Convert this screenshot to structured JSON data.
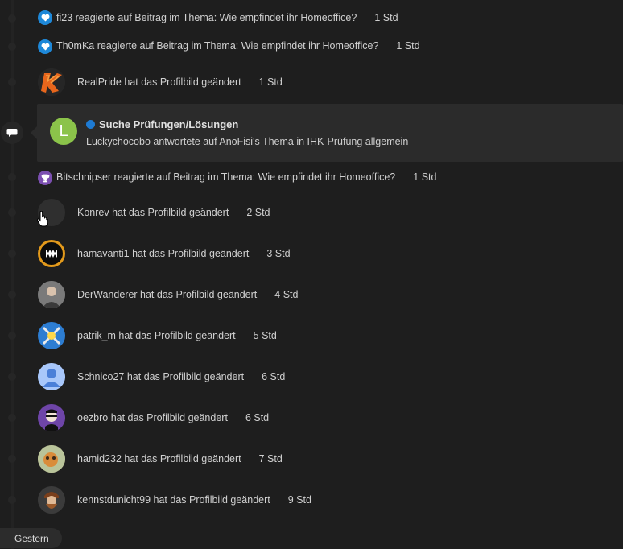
{
  "colors": {
    "background": "#1e1e1e",
    "card": "#2b2b2b",
    "heart": "#1e88d8",
    "trophy": "#7b4fb0",
    "unread": "#1e7bd4"
  },
  "items": [
    {
      "text": "fi23 reagierte auf Beitrag im Thema: Wie empfindet ihr Homeoffice?",
      "time": "1 Std",
      "icon": "heart-icon"
    },
    {
      "text": "Th0mKa reagierte auf Beitrag im Thema: Wie empfindet ihr Homeoffice?",
      "time": "1 Std",
      "icon": "heart-icon"
    },
    {
      "text": "RealPride hat das Profilbild geändert",
      "time": "1 Std",
      "icon": "avatar"
    },
    {
      "text": "Bitschnipser reagierte auf Beitrag im Thema: Wie empfindet ihr Homeoffice?",
      "time": "1 Std",
      "icon": "trophy-icon"
    },
    {
      "text": "Konrev hat das Profilbild geändert",
      "time": "2 Std",
      "icon": "avatar"
    },
    {
      "text": "hamavanti1 hat das Profilbild geändert",
      "time": "3 Std",
      "icon": "avatar"
    },
    {
      "text": "DerWanderer hat das Profilbild geändert",
      "time": "4 Std",
      "icon": "avatar"
    },
    {
      "text": "patrik_m hat das Profilbild geändert",
      "time": "5 Std",
      "icon": "avatar"
    },
    {
      "text": "Schnico27 hat das Profilbild geändert",
      "time": "6 Std",
      "icon": "avatar"
    },
    {
      "text": "oezbro hat das Profilbild geändert",
      "time": "6 Std",
      "icon": "avatar"
    },
    {
      "text": "hamid232 hat das Profilbild geändert",
      "time": "7 Std",
      "icon": "avatar"
    },
    {
      "text": "kennstdunicht99 hat das Profilbild geändert",
      "time": "9 Std",
      "icon": "avatar"
    }
  ],
  "card": {
    "avatar_letter": "L",
    "title": "Suche Prüfungen/Lösungen",
    "subtitle": "Luckychocobo antwortete auf AnoFisi's Thema in IHK-Prüfung allgemein",
    "icon": "chat-bubble-icon"
  },
  "day_label": "Gestern"
}
